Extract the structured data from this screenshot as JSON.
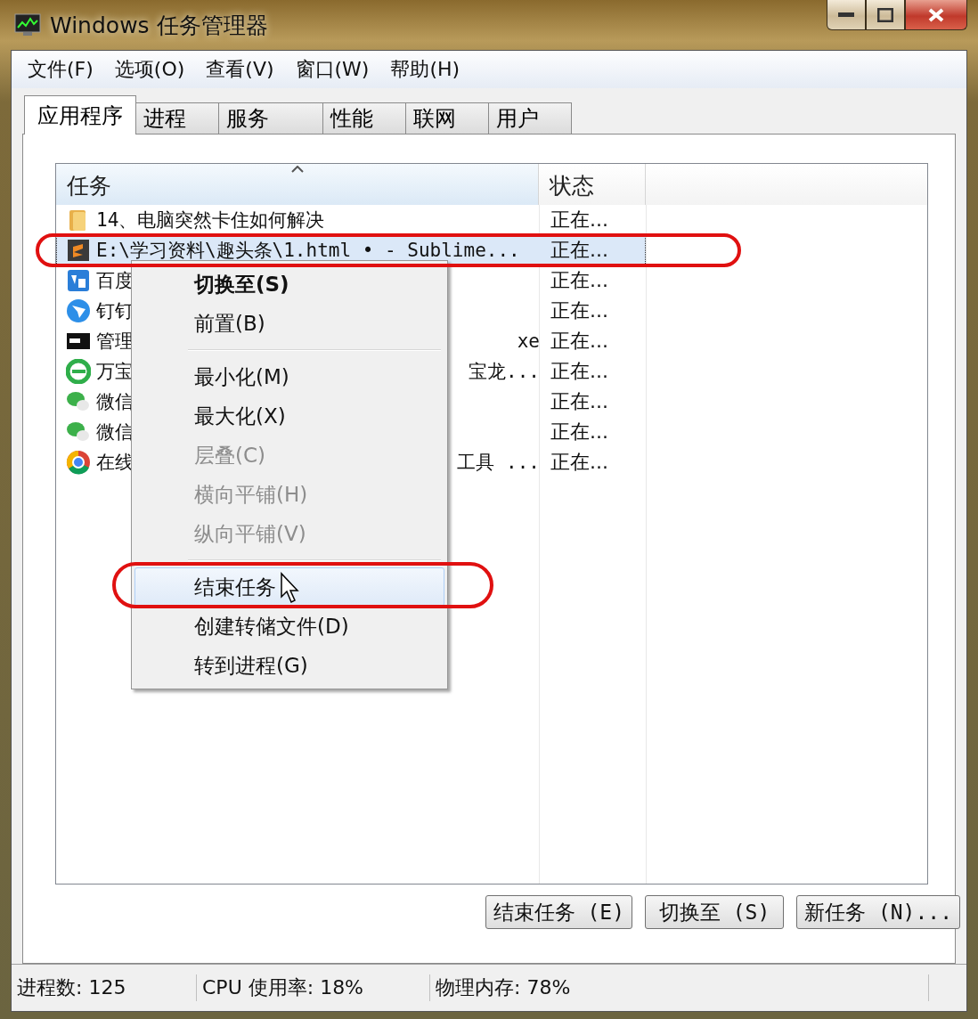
{
  "window": {
    "title": "Windows 任务管理器"
  },
  "menu_bar": [
    "文件(F)",
    "选项(O)",
    "查看(V)",
    "窗口(W)",
    "帮助(H)"
  ],
  "tabs": [
    {
      "label": "应用程序",
      "selected": true
    },
    {
      "label": "进程",
      "selected": false
    },
    {
      "label": "服务",
      "selected": false
    },
    {
      "label": "性能",
      "selected": false
    },
    {
      "label": "联网",
      "selected": false
    },
    {
      "label": "用户",
      "selected": false
    }
  ],
  "table": {
    "columns": [
      "任务",
      "状态"
    ],
    "rows": [
      {
        "kind": "folder",
        "task": "14、电脑突然卡住如何解决",
        "status": "正在...",
        "selected": false
      },
      {
        "kind": "editor",
        "task": "E:\\学习资料\\趣头条\\1.html • - Sublime...",
        "status": "正在...",
        "selected": true
      },
      {
        "kind": "square",
        "task": "百度",
        "status": "正在...",
        "selected": false
      },
      {
        "kind": "bird",
        "task": "钉钉",
        "status": "正在...",
        "selected": false
      },
      {
        "kind": "console",
        "task": "管理",
        "task_tail": "xe",
        "status": "正在...",
        "selected": false
      },
      {
        "kind": "browser",
        "task": "万宝",
        "task_tail": "宝龙...",
        "status": "正在...",
        "selected": false
      },
      {
        "kind": "chat",
        "task": "微信",
        "status": "正在...",
        "selected": false
      },
      {
        "kind": "chat",
        "task": "微信",
        "status": "正在...",
        "selected": false
      },
      {
        "kind": "globe",
        "task": "在线",
        "task_tail": "工具 ...",
        "status": "正在...",
        "selected": false
      }
    ]
  },
  "context_menu": [
    {
      "kind": "item",
      "label": "切换至(S)",
      "default": true,
      "disabled": false,
      "selected": false
    },
    {
      "kind": "item",
      "label": "前置(B)",
      "default": false,
      "disabled": false,
      "selected": false
    },
    {
      "kind": "separator"
    },
    {
      "kind": "item",
      "label": "最小化(M)",
      "default": false,
      "disabled": false,
      "selected": false
    },
    {
      "kind": "item",
      "label": "最大化(X)",
      "default": false,
      "disabled": false,
      "selected": false
    },
    {
      "kind": "item",
      "label": "层叠(C)",
      "default": false,
      "disabled": true,
      "selected": false
    },
    {
      "kind": "item",
      "label": "横向平铺(H)",
      "default": false,
      "disabled": true,
      "selected": false
    },
    {
      "kind": "item",
      "label": "纵向平铺(V)",
      "default": false,
      "disabled": true,
      "selected": false
    },
    {
      "kind": "separator"
    },
    {
      "kind": "item",
      "label": "结束任务",
      "default": false,
      "disabled": false,
      "selected": true
    },
    {
      "kind": "item",
      "label": "创建转储文件(D)",
      "default": false,
      "disabled": false,
      "selected": false
    },
    {
      "kind": "item",
      "label": "转到进程(G)",
      "default": false,
      "disabled": false,
      "selected": false
    }
  ],
  "buttons": [
    "结束任务 (E)",
    "切换至 (S)",
    "新任务 (N)..."
  ],
  "status_bar": [
    "进程数: 125",
    "CPU 使用率: 18%",
    "物理内存: 78%"
  ]
}
